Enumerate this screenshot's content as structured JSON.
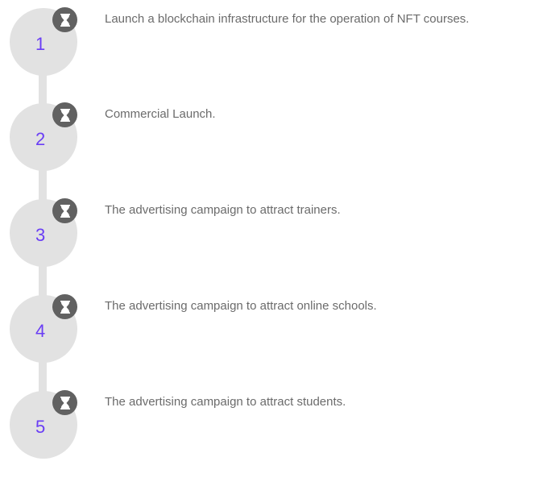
{
  "timeline": {
    "steps": [
      {
        "number": "1",
        "text": "Launch a blockchain infrastructure for the operation of NFT courses.",
        "status_icon": "hourglass-icon"
      },
      {
        "number": "2",
        "text": "Commercial Launch.",
        "status_icon": "hourglass-icon"
      },
      {
        "number": "3",
        "text": "The advertising campaign to attract trainers.",
        "status_icon": "hourglass-icon"
      },
      {
        "number": "4",
        "text": "The advertising campaign to attract online schools.",
        "status_icon": "hourglass-icon"
      },
      {
        "number": "5",
        "text": "The advertising campaign to attract students.",
        "status_icon": "hourglass-icon"
      }
    ]
  },
  "colors": {
    "circle": "#e2e2e2",
    "connector": "#e2e2e2",
    "number": "#6a3ef5",
    "badge": "#616161",
    "text": "#6b6b6b"
  }
}
